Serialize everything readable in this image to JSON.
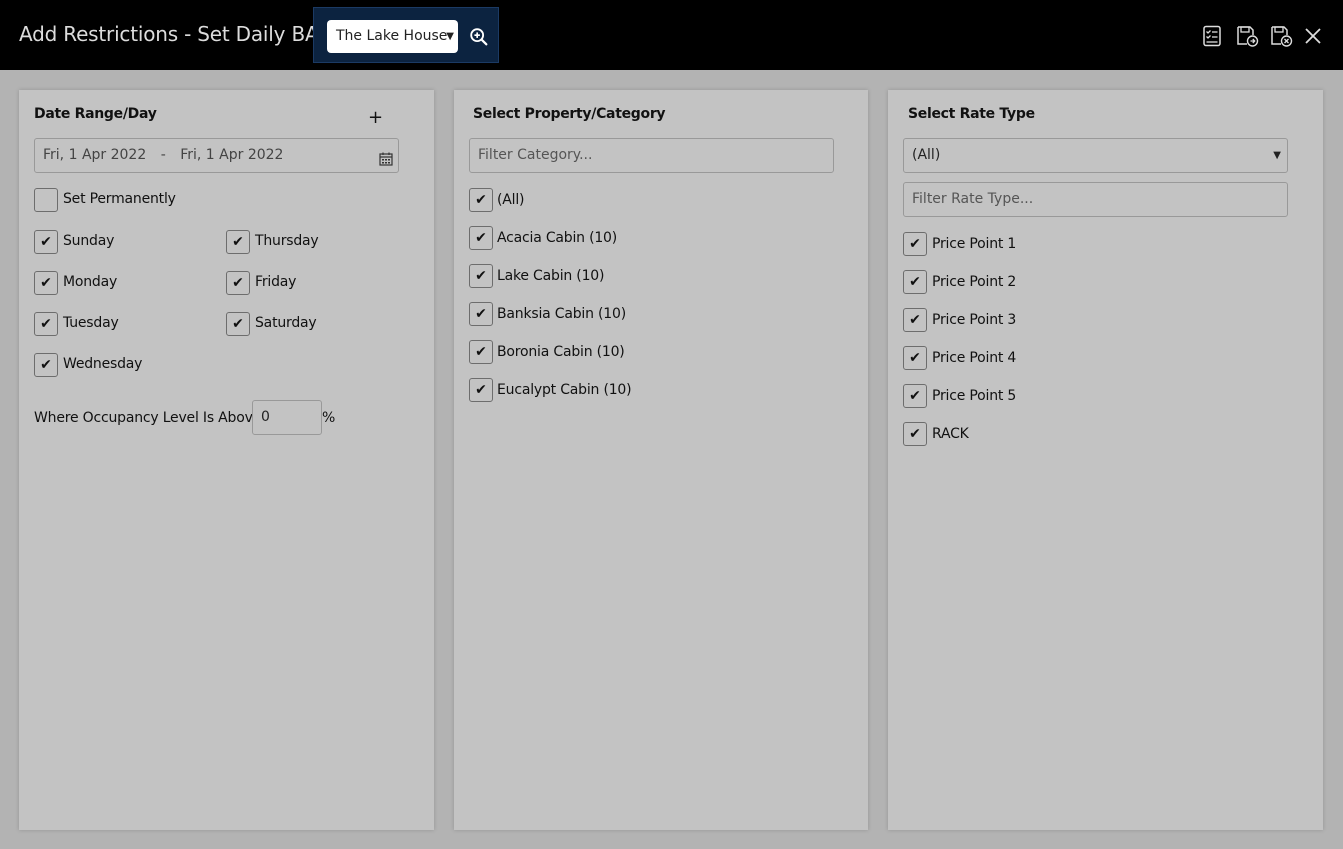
{
  "header": {
    "title": "Add Restrictions - Set Daily BAR",
    "property_select": "The Lake House",
    "icons": [
      "search-plus-icon",
      "checklist-icon",
      "save-forward-icon",
      "save-close-icon",
      "close-icon"
    ]
  },
  "date_panel": {
    "title": "Date Range/Day",
    "add_label": "+",
    "date_from": "Fri, 1 Apr 2022",
    "date_separator": "-",
    "date_to": "Fri, 1 Apr 2022",
    "set_permanently": {
      "label": "Set Permanently",
      "checked": false
    },
    "days": [
      {
        "label": "Sunday",
        "checked": true
      },
      {
        "label": "Monday",
        "checked": true
      },
      {
        "label": "Tuesday",
        "checked": true
      },
      {
        "label": "Wednesday",
        "checked": true
      },
      {
        "label": "Thursday",
        "checked": true
      },
      {
        "label": "Friday",
        "checked": true
      },
      {
        "label": "Saturday",
        "checked": true
      }
    ],
    "occupancy_label": "Where Occupancy Level Is Above",
    "occupancy_value": "0",
    "occupancy_unit": "%"
  },
  "category_panel": {
    "title": "Select Property/Category",
    "filter_placeholder": "Filter Category...",
    "items": [
      {
        "label": "(All)",
        "checked": true
      },
      {
        "label": "Acacia Cabin (10)",
        "checked": true
      },
      {
        "label": "Lake Cabin (10)",
        "checked": true
      },
      {
        "label": "Banksia Cabin (10)",
        "checked": true
      },
      {
        "label": "Boronia Cabin (10)",
        "checked": true
      },
      {
        "label": "Eucalypt Cabin (10)",
        "checked": true
      }
    ]
  },
  "rate_panel": {
    "title": "Select Rate Type",
    "select_value": "(All)",
    "filter_placeholder": "Filter Rate Type...",
    "items": [
      {
        "label": "Price Point 1",
        "checked": true
      },
      {
        "label": "Price Point 2",
        "checked": true
      },
      {
        "label": "Price Point 3",
        "checked": true
      },
      {
        "label": "Price Point 4",
        "checked": true
      },
      {
        "label": "Price Point 5",
        "checked": true
      },
      {
        "label": "RACK",
        "checked": true
      }
    ]
  }
}
